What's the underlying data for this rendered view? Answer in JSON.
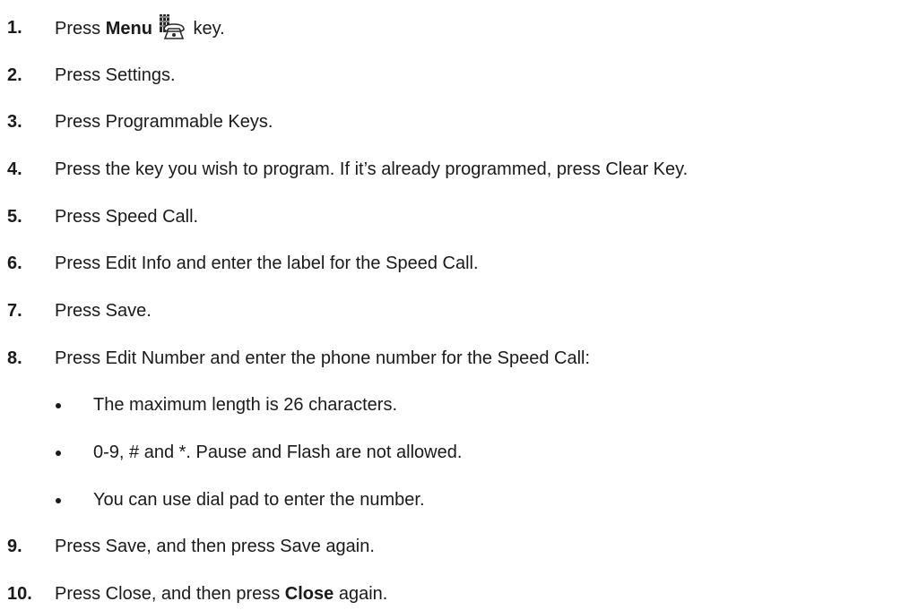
{
  "steps": [
    {
      "num": "1.",
      "pre": "Press ",
      "bold": "Menu",
      "icon": "menu-phone-icon",
      "post": " key."
    },
    {
      "num": "2.",
      "text": "Press Settings."
    },
    {
      "num": "3.",
      "text": "Press Programmable Keys."
    },
    {
      "num": "4.",
      "text": "Press the key you wish to program. If it’s already programmed, press Clear Key."
    },
    {
      "num": "5.",
      "text": "Press Speed Call."
    },
    {
      "num": "6.",
      "text": "Press Edit Info and enter the label for the Speed Call."
    },
    {
      "num": "7.",
      "text": "Press Save."
    },
    {
      "num": "8.",
      "text": "Press Edit Number and enter the phone number for the Speed Call:"
    },
    {
      "num": "9.",
      "text": "Press Save, and then press Save again."
    },
    {
      "num": "10.",
      "pre": "Press Close, and then press ",
      "bold": "Close",
      "post": " again."
    }
  ],
  "bullets": [
    "The maximum length is 26 characters.",
    "0-9, # and *. Pause and Flash are not allowed.",
    "You can use dial pad to enter the number."
  ]
}
